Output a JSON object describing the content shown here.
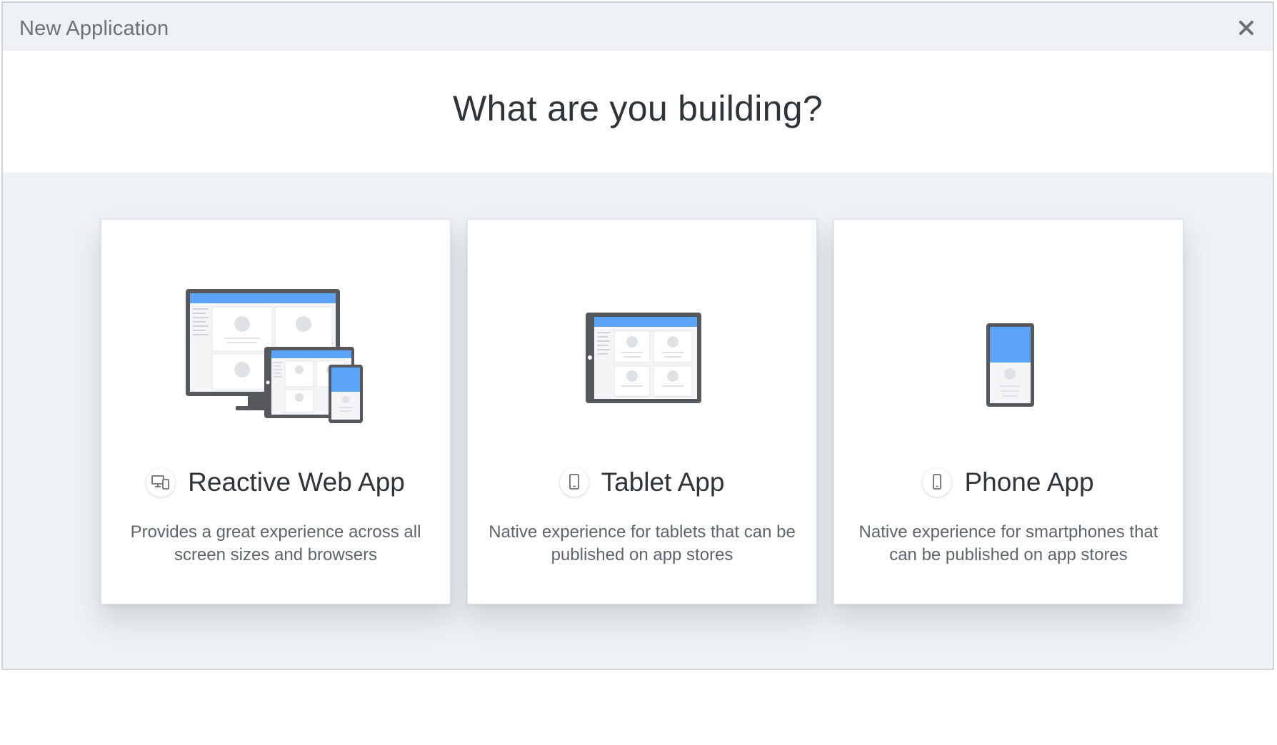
{
  "dialog": {
    "title": "New Application",
    "heading": "What are you building?"
  },
  "cards": [
    {
      "title": "Reactive Web App",
      "description": "Provides a great experience across all screen sizes and browsers",
      "icon": "multi-device-icon"
    },
    {
      "title": "Tablet App",
      "description": "Native experience for tablets that can be published on app stores",
      "icon": "tablet-icon"
    },
    {
      "title": "Phone App",
      "description": "Native experience for smartphones that can be published on app stores",
      "icon": "phone-icon"
    }
  ],
  "colors": {
    "accent": "#5ba4f8",
    "device_frame": "#55595d",
    "background": "#eef2f5"
  }
}
